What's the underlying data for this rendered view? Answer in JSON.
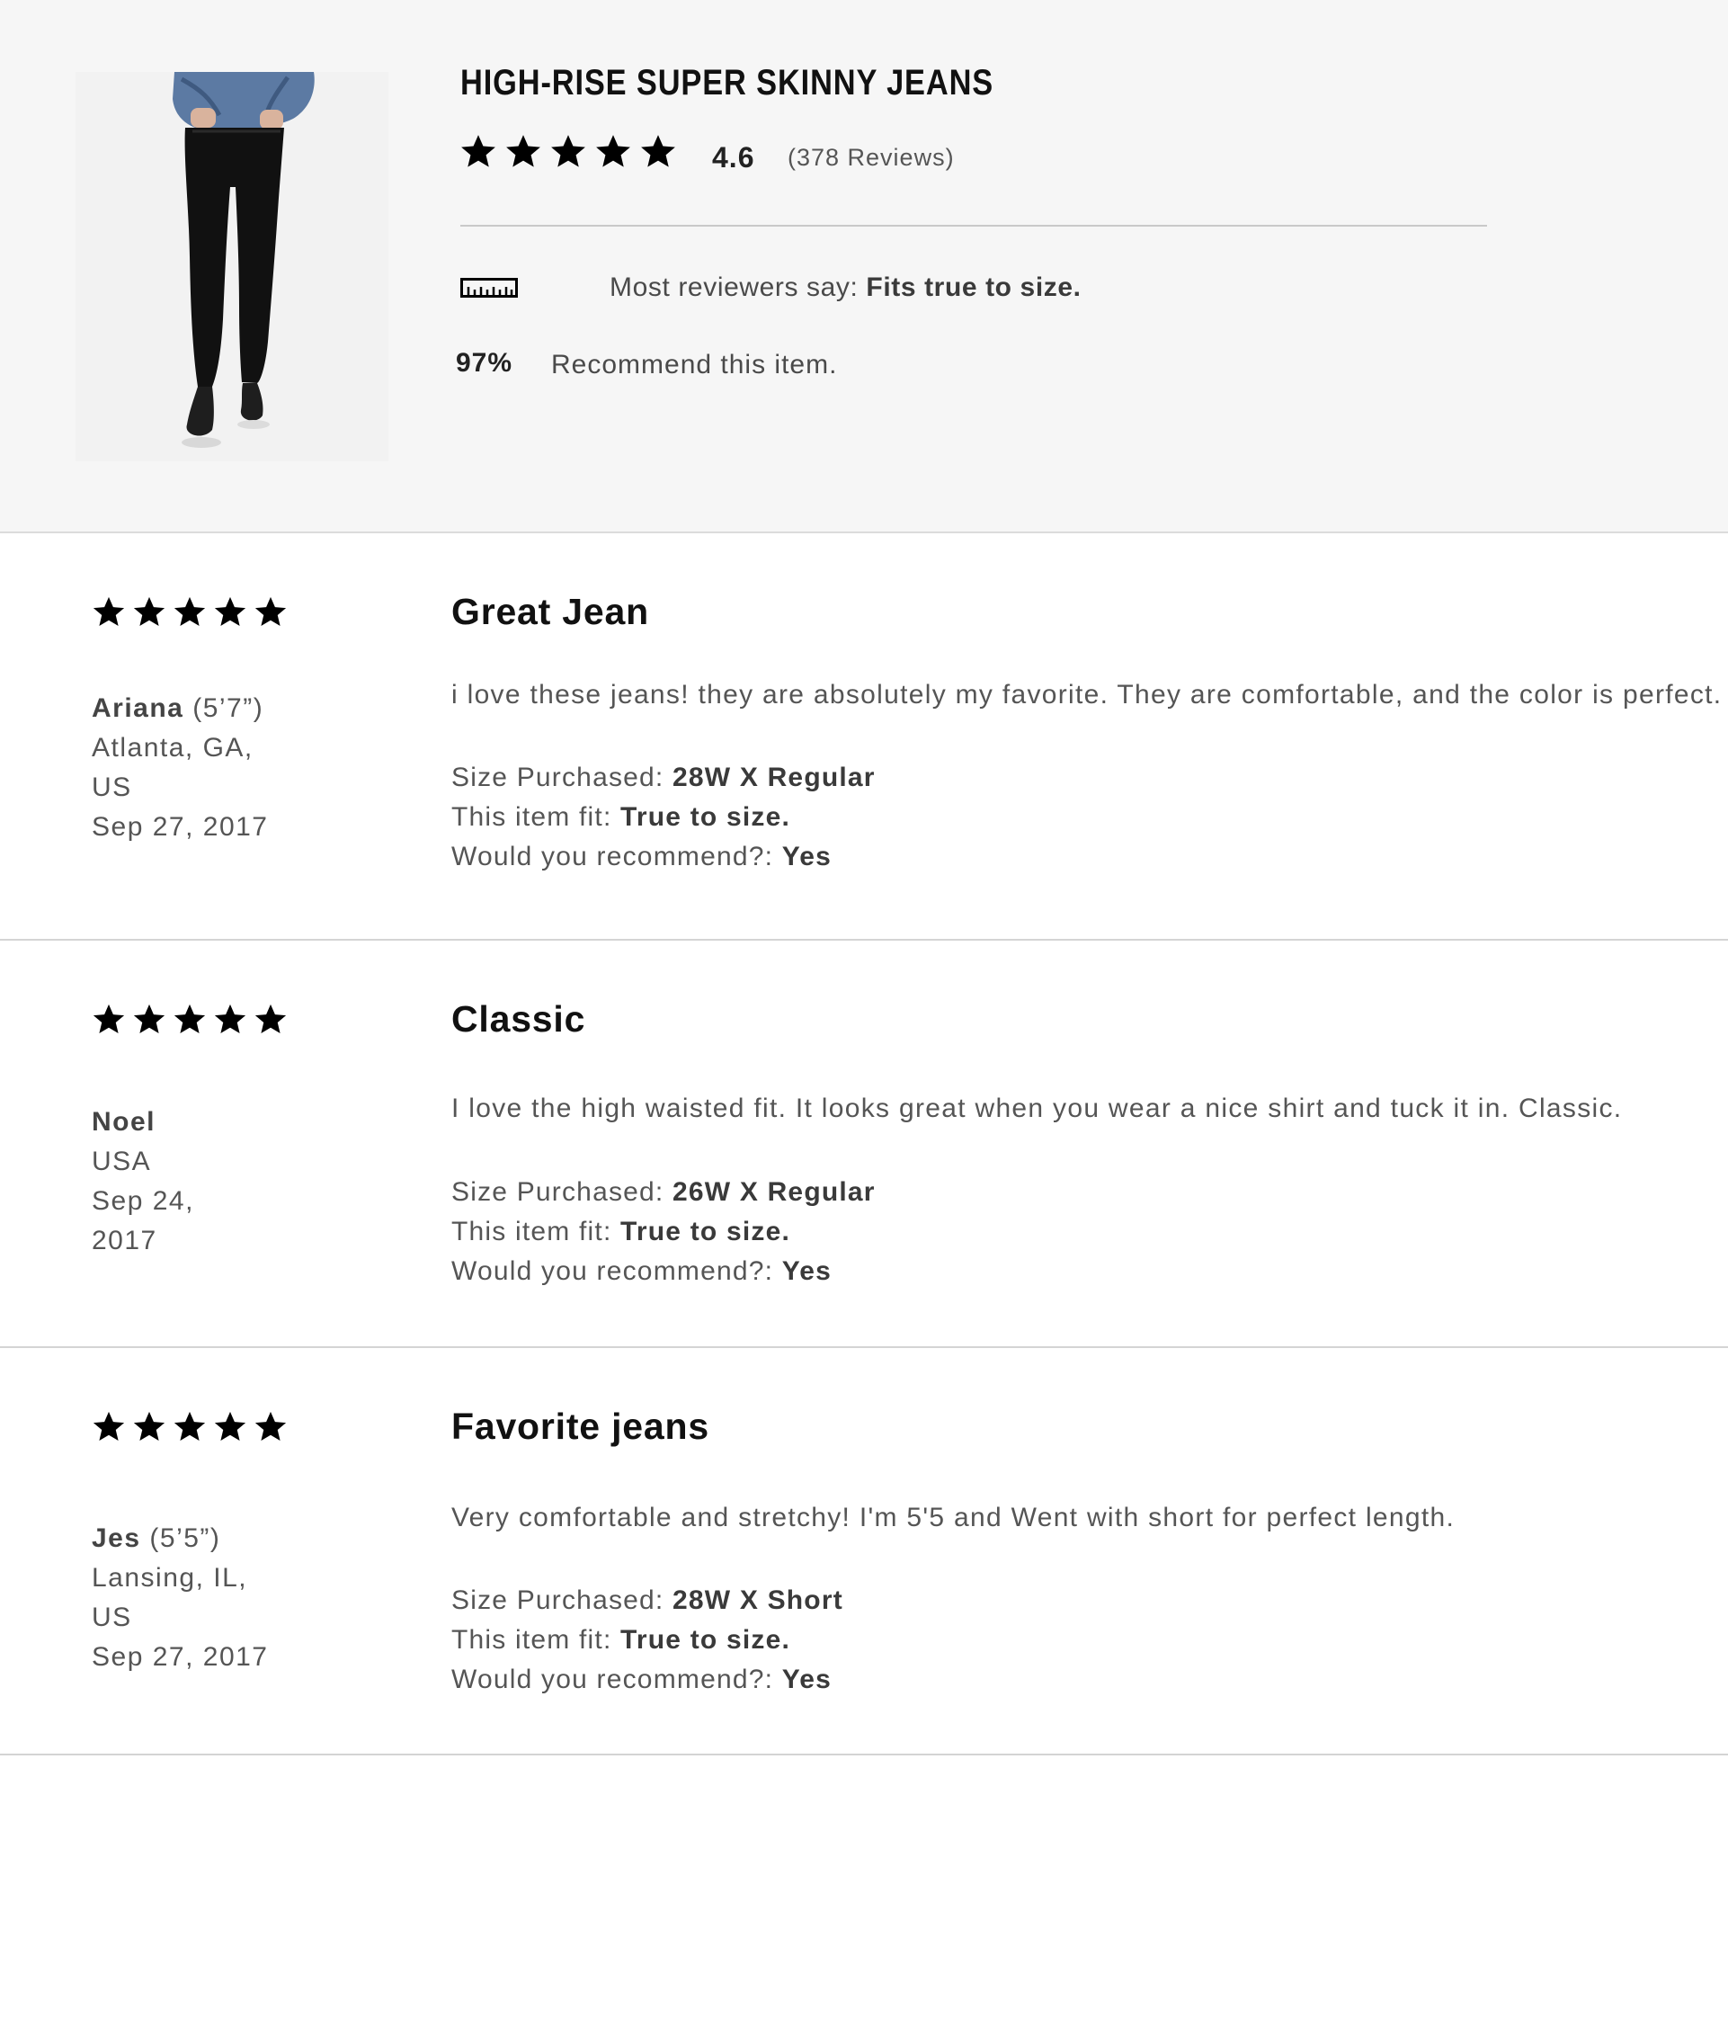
{
  "product": {
    "title": "HIGH-RISE SUPER SKINNY JEANS",
    "image_alt": "model wearing black high-rise super skinny jeans",
    "rating": "4.6",
    "stars": 5,
    "review_count": "(378 Reviews)",
    "fit_icon": "ruler-icon",
    "fit_prefix": "Most reviewers say: ",
    "fit_value": "Fits true to size.",
    "recommend_percent": "97%",
    "recommend_text": "Recommend this item."
  },
  "reviews": [
    {
      "stars": 5,
      "name": "Ariana",
      "height": " (5’7”)",
      "location_lines": [
        "Atlanta, GA,",
        "US"
      ],
      "date_lines": [
        "Sep 27, 2017"
      ],
      "title": "Great Jean",
      "body": "i love these jeans! they are absolutely my favorite. They are comfortable, and the color is perfect.",
      "size_label": "Size Purchased: ",
      "size_value": "28W X Regular",
      "fit_label": "This item fit: ",
      "fit_value": "True to size.",
      "recommend_label": "Would you recommend?: ",
      "recommend_value": "Yes"
    },
    {
      "stars": 5,
      "name": "Noel",
      "height": "",
      "location_lines": [
        "USA"
      ],
      "date_lines": [
        "Sep 24,",
        "2017"
      ],
      "title": "Classic",
      "body": "I love the high waisted fit. It looks great when you wear a nice shirt and tuck it in. Classic.",
      "size_label": "Size Purchased: ",
      "size_value": "26W X Regular",
      "fit_label": "This item fit: ",
      "fit_value": "True to size.",
      "recommend_label": "Would you recommend?: ",
      "recommend_value": "Yes"
    },
    {
      "stars": 5,
      "name": "Jes",
      "height": " (5’5”)",
      "location_lines": [
        "Lansing, IL,",
        "US"
      ],
      "date_lines": [
        "Sep 27, 2017"
      ],
      "title": "Favorite jeans",
      "body": "Very comfortable and stretchy! I'm 5'5 and Went with short for perfect length.",
      "size_label": "Size Purchased: ",
      "size_value": "28W X Short",
      "fit_label": "This item fit: ",
      "fit_value": "True to size.",
      "recommend_label": "Would you recommend?: ",
      "recommend_value": "Yes"
    }
  ]
}
